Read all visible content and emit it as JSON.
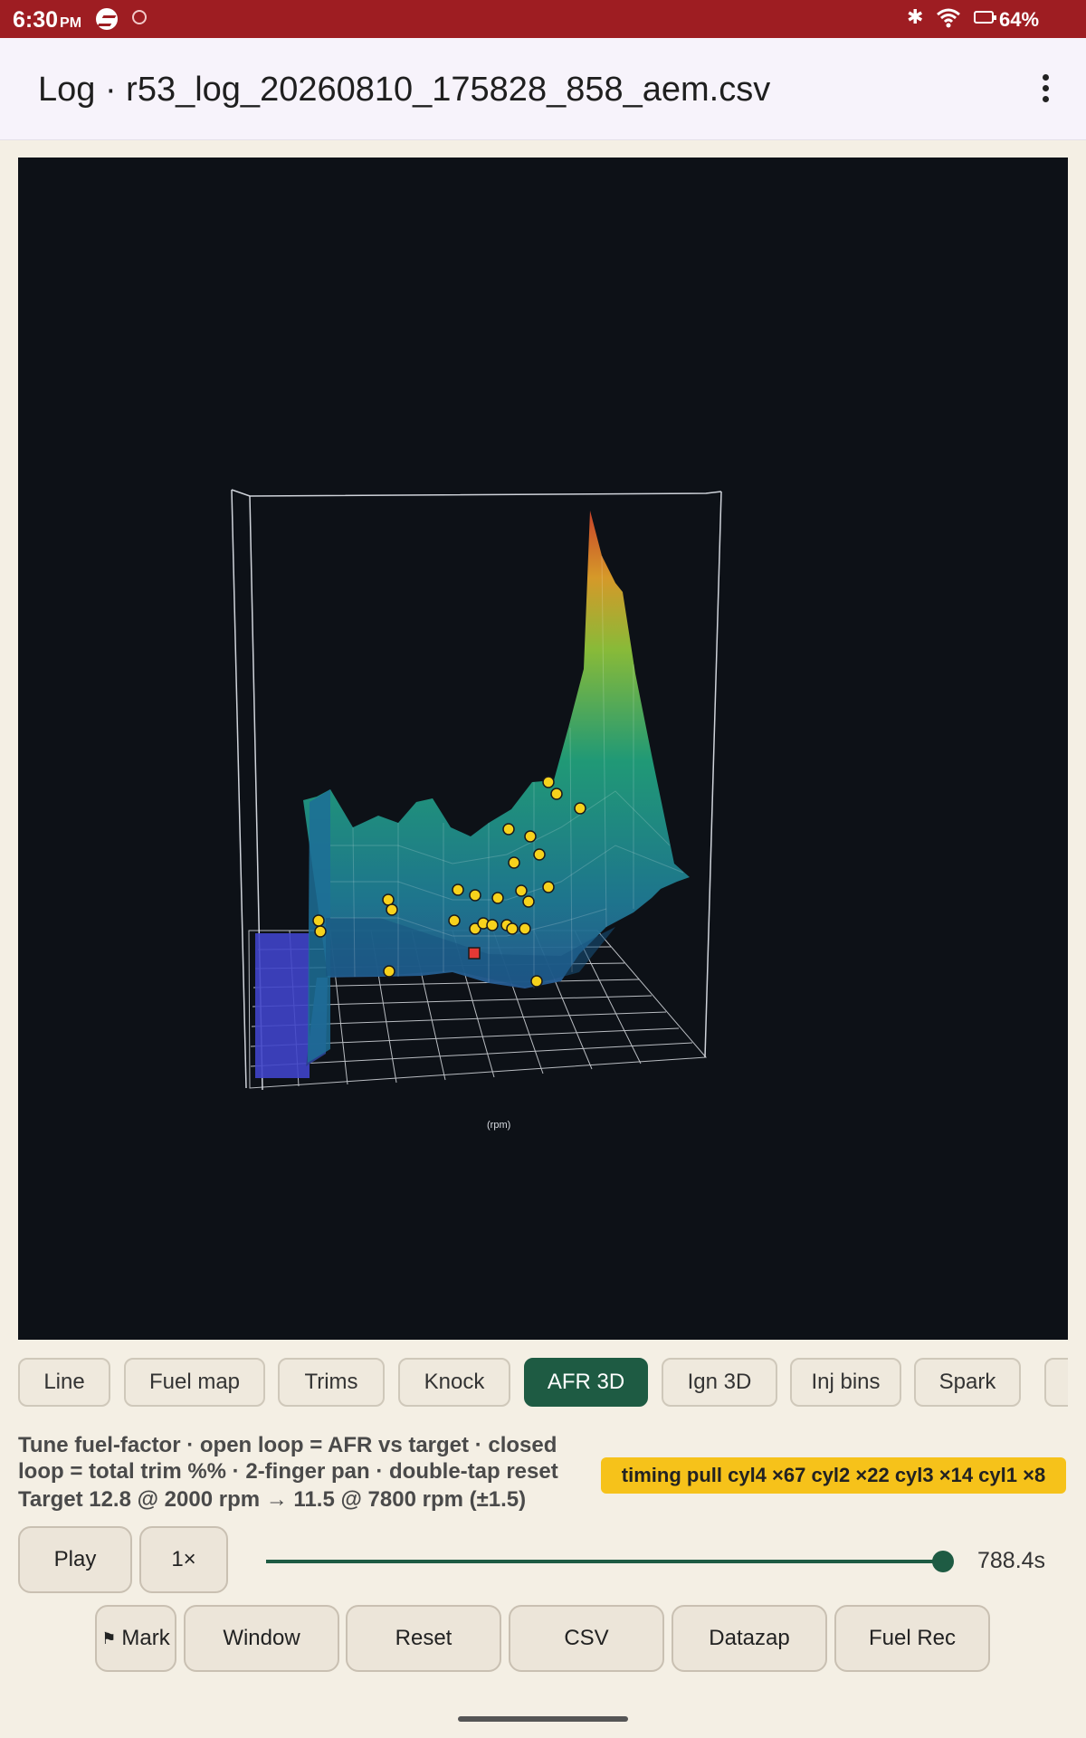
{
  "status_bar": {
    "time": "6:30",
    "ampm": "PM",
    "battery": "64%"
  },
  "app_bar": {
    "title": "Log · r53_log_20260810_175828_858_aem.csv",
    "menu_icon": "more-vert-icon"
  },
  "plot": {
    "type": "3d-surface",
    "x_axis_label": "(rpm)",
    "colors": {
      "background": "#0d1117",
      "point": "#f7d21c",
      "current_point": "#e53935",
      "grid": "#ffffff"
    }
  },
  "chips": [
    "Line",
    "Fuel map",
    "Trims",
    "Knock",
    "AFR 3D",
    "Ign 3D",
    "Inj bins",
    "Spark"
  ],
  "active_chip": "AFR 3D",
  "info": {
    "description": "Tune fuel-factor · open loop = AFR vs target · closed loop = total trim %% · 2-finger pan · double-tap reset",
    "target": "Target 12.8 @ 2000 rpm → 11.5 @ 7800 rpm (±1.5)"
  },
  "knock_badge": "timing pull cyl4 ×67  cyl2 ×22  cyl3 ×14  cyl1 ×8",
  "playback": {
    "play_label": "Play",
    "speed_label": "1×",
    "time_label": "788.4s"
  },
  "actions": {
    "mark_label": "Mark",
    "window_label": "Window",
    "reset_label": "Reset",
    "csv_label": "CSV",
    "datazap_label": "Datazap",
    "fuel_rec_label": "Fuel Rec"
  },
  "colors": {
    "status_bar": "#9e1d22",
    "accent": "#1e5b43",
    "badge": "#f6c21a",
    "surface_bg": "#f4efe4"
  }
}
